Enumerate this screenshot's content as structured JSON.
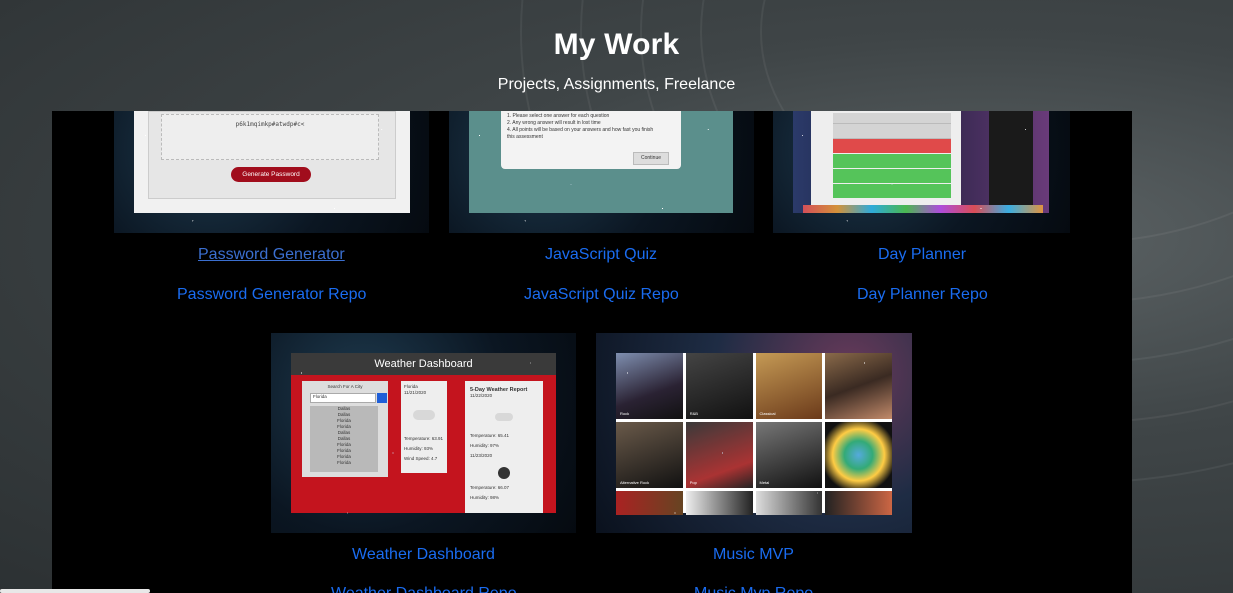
{
  "header": {
    "title": "My Work",
    "subtitle": "Projects, Assignments, Freelance"
  },
  "projects": [
    {
      "link_label": "Password Generator",
      "repo_label": "Password Generator Repo",
      "preview": {
        "password_text": "p6k1mqimkp#atwdp#c<",
        "button_label": "Generate Password"
      }
    },
    {
      "link_label": "JavaScript Quiz",
      "repo_label": "JavaScript Quiz Repo",
      "preview": {
        "lines": [
          "1. Please select one answer for each question",
          "2. Any wrong answer will result in lost time",
          "4. All points will be based on your answers and how fast you finish",
          "this assessment"
        ],
        "button_label": "Continue"
      }
    },
    {
      "link_label": "Day Planner",
      "repo_label": "Day Planner Repo"
    },
    {
      "link_label": "Weather Dashboard",
      "repo_label": "Weather Dashboard Repo",
      "preview": {
        "title": "Weather Dashboard",
        "search_label": "Search For A City",
        "search_value": "Florida",
        "cities": [
          "Dallas",
          "Dallas",
          "Florida",
          "Florida",
          "Dallas",
          "Dallas",
          "Florida",
          "Florida",
          "Florida",
          "Florida"
        ],
        "current_city": "Florida",
        "current_date": "11/21/2020",
        "temperature": "Temperature: 63.91",
        "humidity": "Humidity: 93%",
        "wind": "Wind Speed: 4.7",
        "forecast_title": "5-Day Weather Report",
        "forecast_date1": "11/22/2020",
        "forecast_temp1": "Temperature: 65.41",
        "forecast_humidity1": "Humidity: 97%",
        "forecast_date2": "11/23/2020",
        "forecast_temp2": "Temperature: 66.07",
        "forecast_humidity2": "Humidity: 98%"
      }
    },
    {
      "link_label": "Music MVP",
      "repo_label": "Music Mvp Repo",
      "preview": {
        "tiles": [
          "Rock",
          "R&B",
          "Classical",
          "",
          "Alternative Rock",
          "Pop",
          "Metal",
          ""
        ]
      }
    }
  ],
  "colors": {
    "link": "#1a6cf0",
    "panel": "#000000",
    "weather_red": "#c4141e"
  }
}
